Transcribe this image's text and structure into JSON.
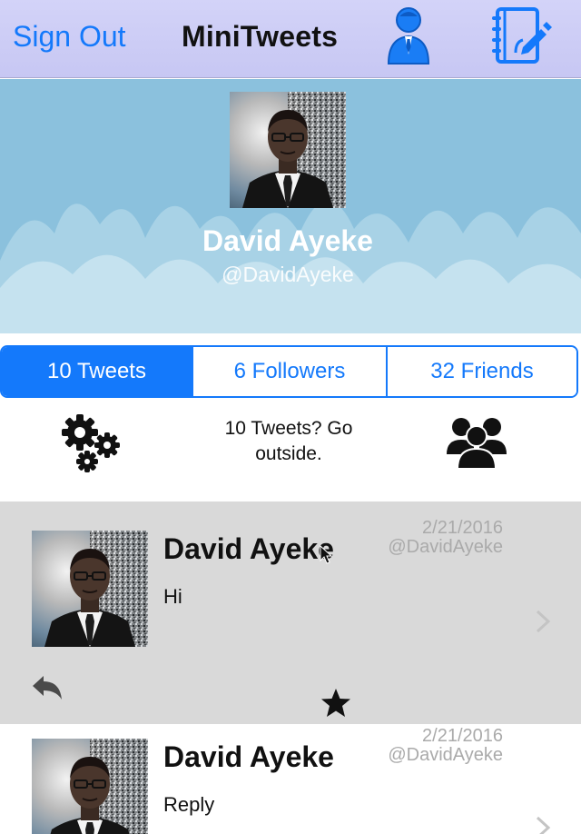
{
  "navbar": {
    "signout_label": "Sign Out",
    "title": "MiniTweets",
    "profile_icon": "user-icon",
    "compose_icon": "compose-icon"
  },
  "header": {
    "name": "David Ayeke",
    "handle": "@DavidAyeke"
  },
  "tabs": [
    {
      "label": "10 Tweets",
      "active": true
    },
    {
      "label": "6 Followers",
      "active": false
    },
    {
      "label": "32 Friends",
      "active": false
    }
  ],
  "info": {
    "message": "10 Tweets? Go outside.",
    "settings_icon": "gears-icon",
    "friends_icon": "group-icon"
  },
  "tweets": [
    {
      "name": "David Ayeke",
      "date": "2/21/2016",
      "handle": "@DavidAyeke",
      "text": "Hi",
      "selected": true
    },
    {
      "name": "David Ayeke",
      "date": "2/21/2016",
      "handle": "@DavidAyeke",
      "text": "Reply",
      "selected": false
    }
  ],
  "colors": {
    "accent": "#1479fb",
    "navbar": "#cfcff6",
    "header_bg": "#8bc1dd",
    "selected_row": "#d9d9d9",
    "muted_text": "#aaaaaa"
  }
}
